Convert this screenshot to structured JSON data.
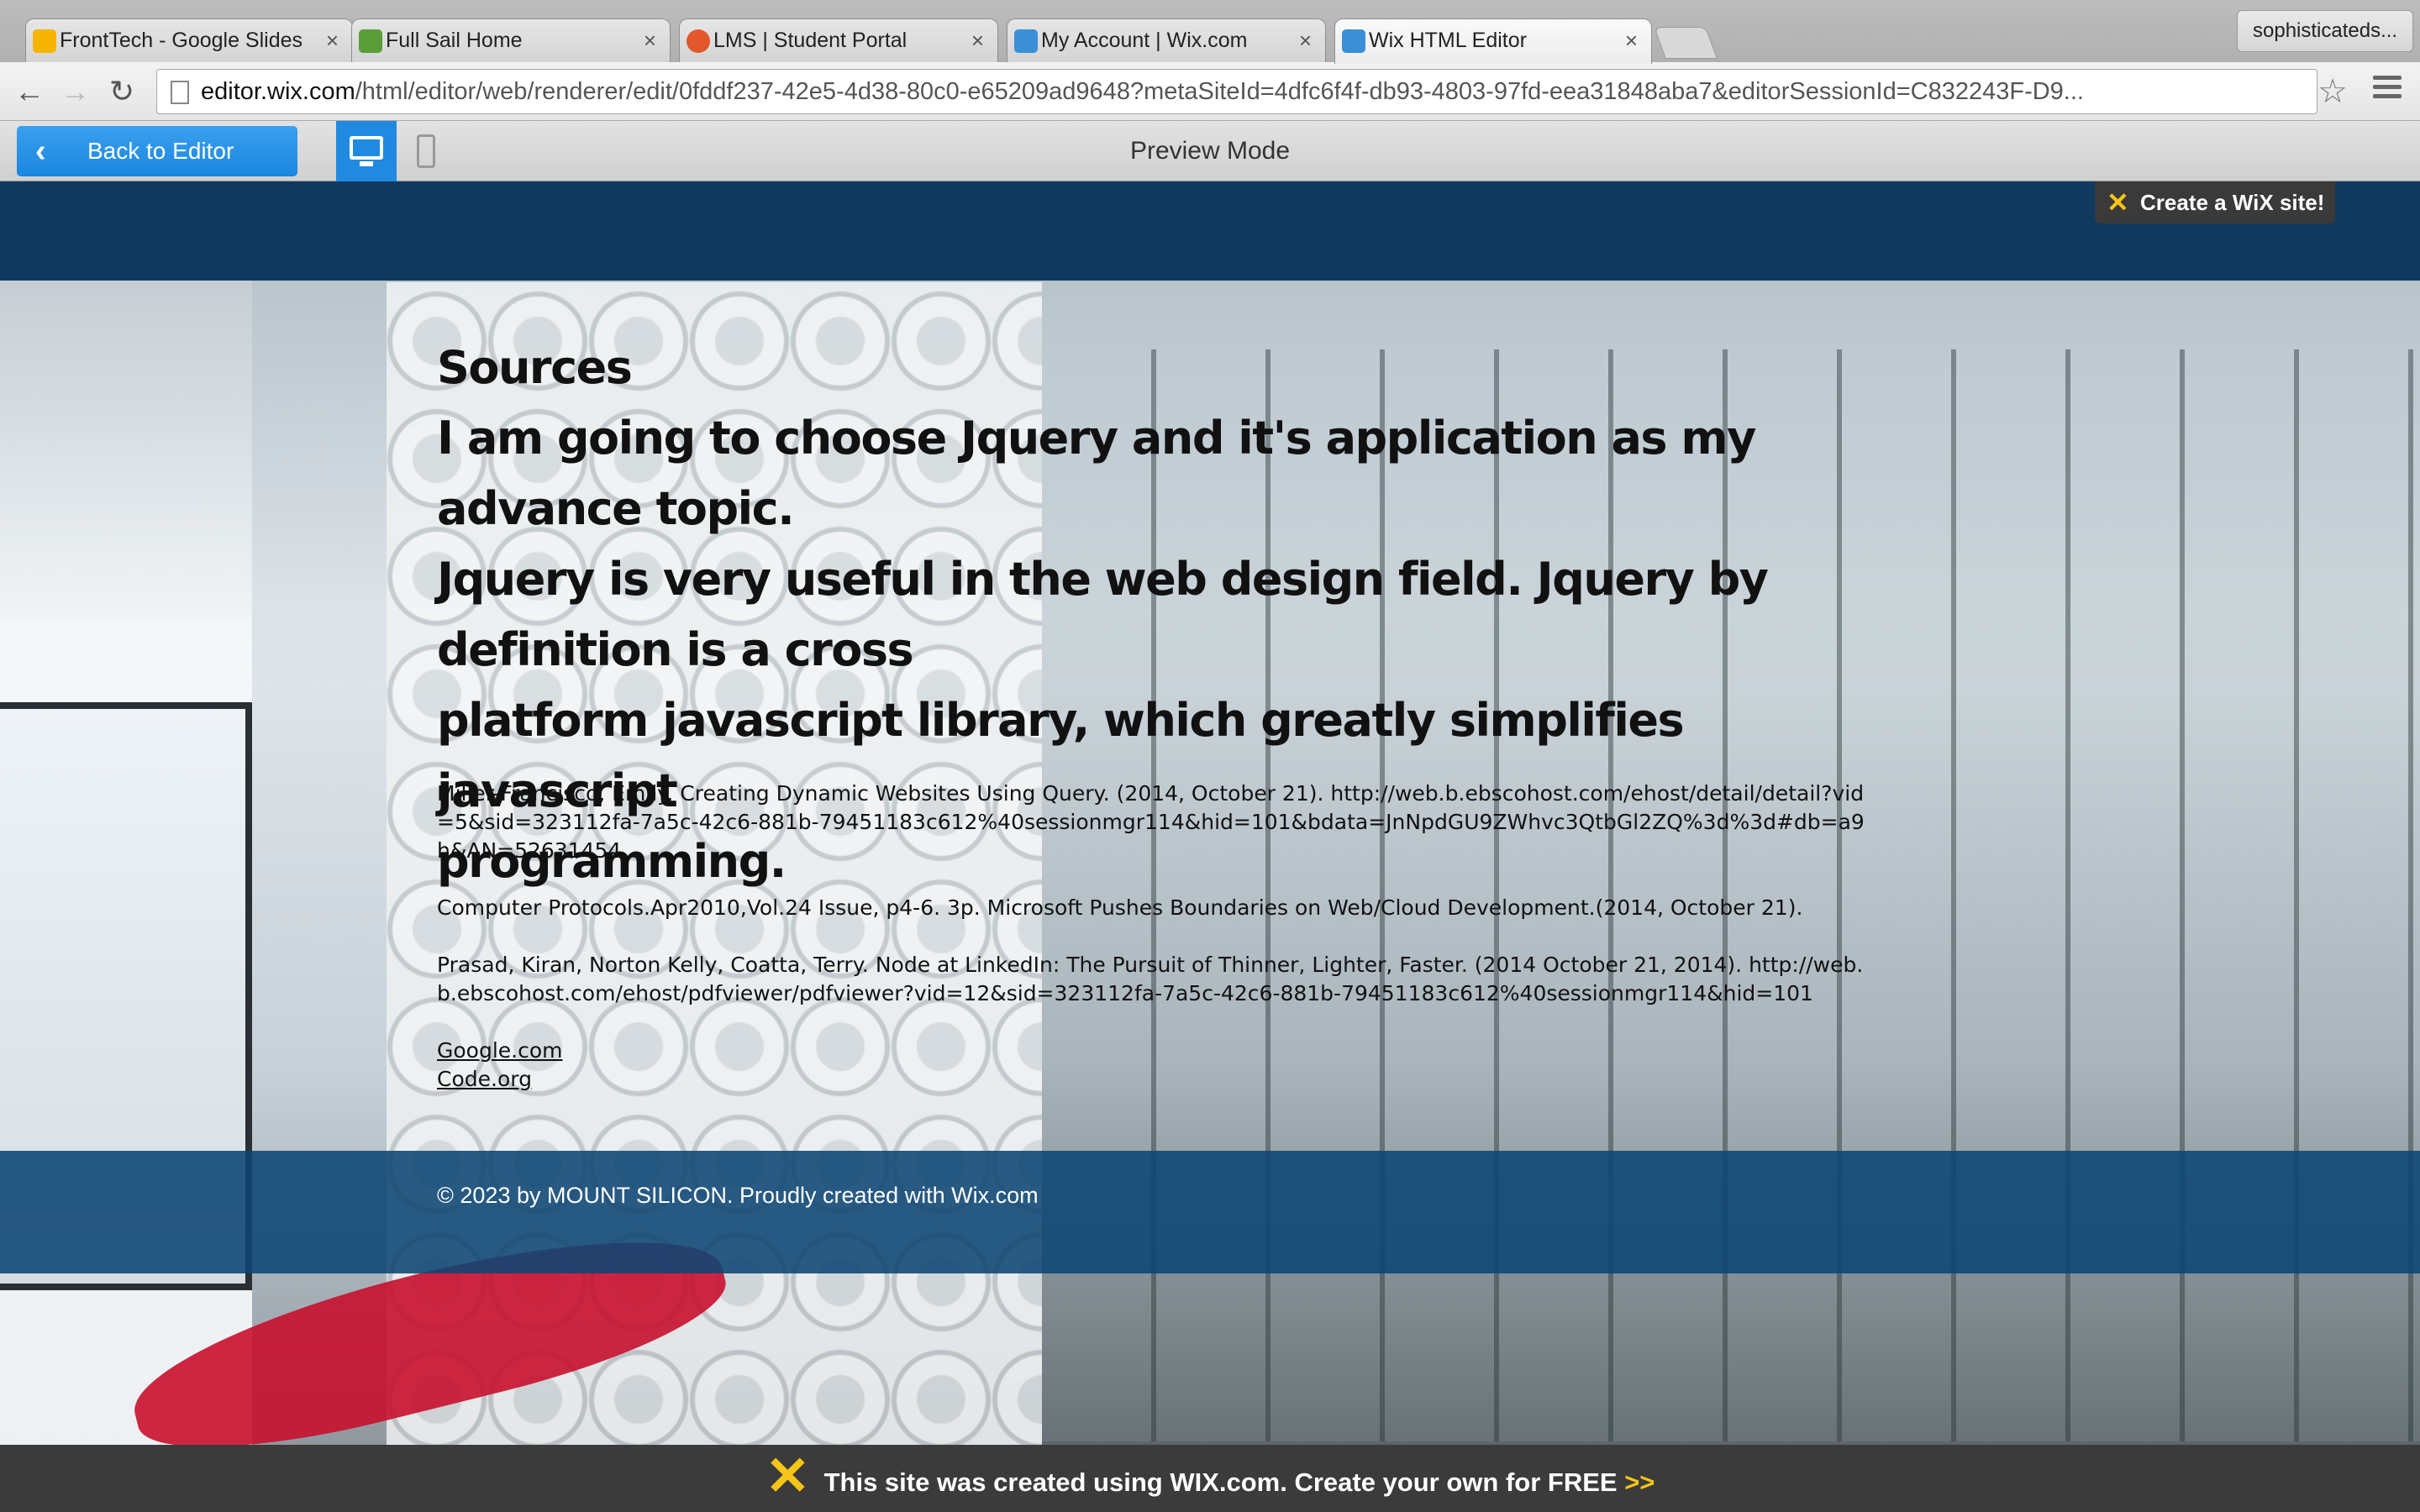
{
  "browser": {
    "tabs": [
      {
        "title": "FrontTech - Google Slides",
        "color": "#f4b400"
      },
      {
        "title": "Full Sail Home",
        "color": "#5a9e3a"
      },
      {
        "title": "LMS | Student Portal",
        "color": "#e2572b"
      },
      {
        "title": "My Account | Wix.com",
        "color": "#3a8fd6"
      },
      {
        "title": "Wix HTML Editor",
        "color": "#3a8fd6"
      }
    ],
    "tab_close": "×",
    "profile": "sophisticateds...",
    "url_host": "editor.wix.com",
    "url_path": "/html/editor/web/renderer/edit/0fddf237-42e5-4d38-80c0-e65209ad9648?metaSiteId=4dfc6f4f-db93-4803-97fd-eea31848aba7&editorSessionId=C832243F-D9...",
    "back": "←",
    "forward": "→",
    "reload": "↻",
    "star": "☆"
  },
  "preview_bar": {
    "back_label": "Back to Editor",
    "back_chevron": "‹",
    "title": "Preview Mode"
  },
  "site": {
    "create_badge": "Create a WiX site!",
    "x_glyph": "✕",
    "heading_lines": [
      "Sources",
      "I am going to choose Jquery and it's application as my advance topic.",
      "Jquery is very useful in the web design field. Jquery by definition is a cross",
      "platform javascript library, which greatly simplifies javascript",
      "programming."
    ],
    "references": [
      "Miller-Francisco, Emily. Creating Dynamic Websites Using Query. (2014, October 21). http://web.b.ebscohost.com/ehost/detail/detail?vid=5&sid=323112fa-7a5c-42c6-881b-79451183c612%40sessionmgr114&hid=101&bdata=JnNpdGU9ZWhvc3QtbGl2ZQ%3d%3d#db=a9h&AN=52631454",
      "Computer Protocols.Apr2010,Vol.24 Issue, p4-6. 3p.  Microsoft Pushes Boundaries on Web/Cloud Development.(2014, October 21).",
      "Prasad, Kiran, Norton Kelly, Coatta, Terry. Node at LinkedIn: The Pursuit of Thinner, Lighter, Faster. (2014 October 21, 2014). http://web.b.ebscohost.com/ehost/pdfviewer/pdfviewer?vid=12&sid=323112fa-7a5c-42c6-881b-79451183c612%40sessionmgr114&hid=101"
    ],
    "links": [
      "Google.com",
      "Code.org"
    ],
    "footer": "© 2023 by MOUNT SILICON. Proudly created with Wix.com"
  },
  "banner": {
    "text": "This site was created using WIX.com. Create your own for FREE ",
    "arrows": ">>"
  }
}
